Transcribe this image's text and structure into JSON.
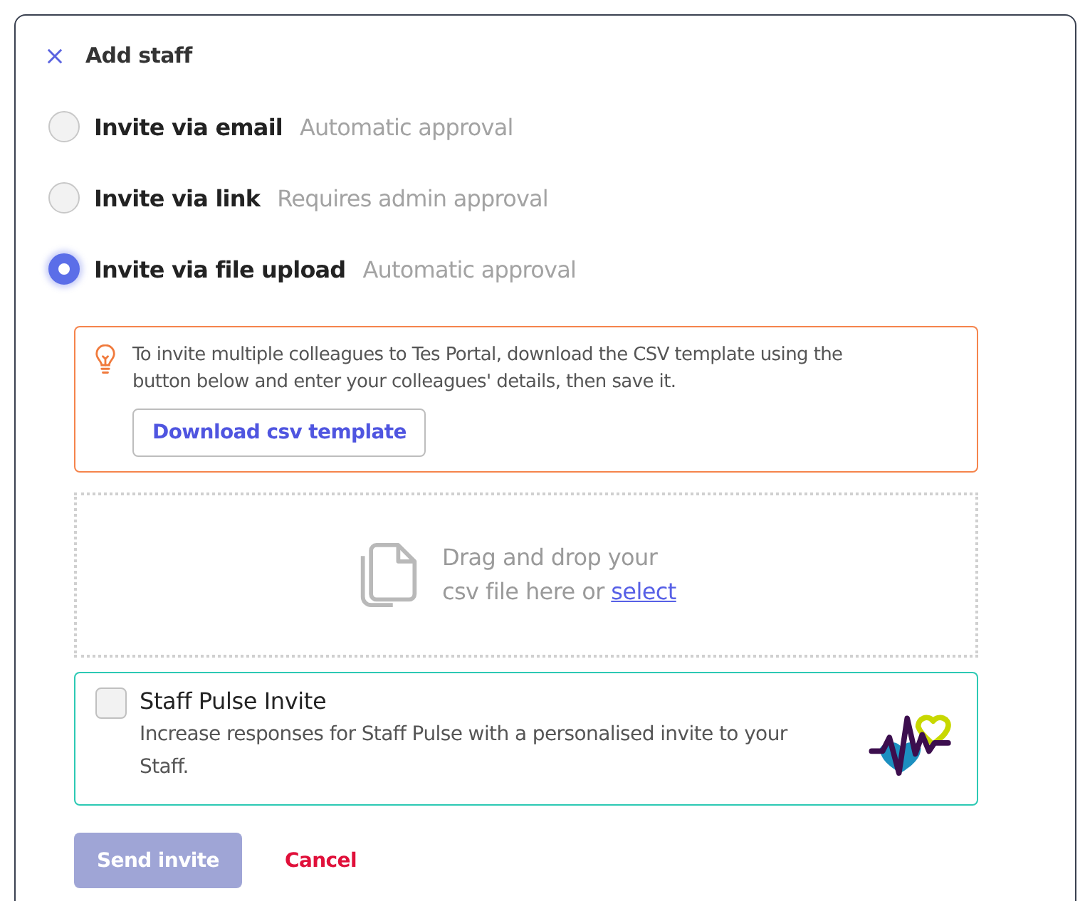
{
  "dialog": {
    "title": "Add staff"
  },
  "options": [
    {
      "label": "Invite via email",
      "note": "Automatic approval",
      "selected": false
    },
    {
      "label": "Invite via link",
      "note": "Requires admin approval",
      "selected": false
    },
    {
      "label": "Invite via file upload",
      "note": "Automatic approval",
      "selected": true
    }
  ],
  "info": {
    "text": "To invite multiple colleagues to Tes Portal, download the CSV template using the button below and enter your colleagues' details, then save it.",
    "button": "Download csv template"
  },
  "dropzone": {
    "text": "Drag and drop your csv file here or",
    "link": "select"
  },
  "pulse": {
    "title": "Staff Pulse Invite",
    "description": "Increase responses for Staff Pulse with a personalised invite to your Staff.",
    "checked": false
  },
  "actions": {
    "send": {
      "label": "Send invite",
      "disabled": true
    },
    "cancel": "Cancel"
  }
}
